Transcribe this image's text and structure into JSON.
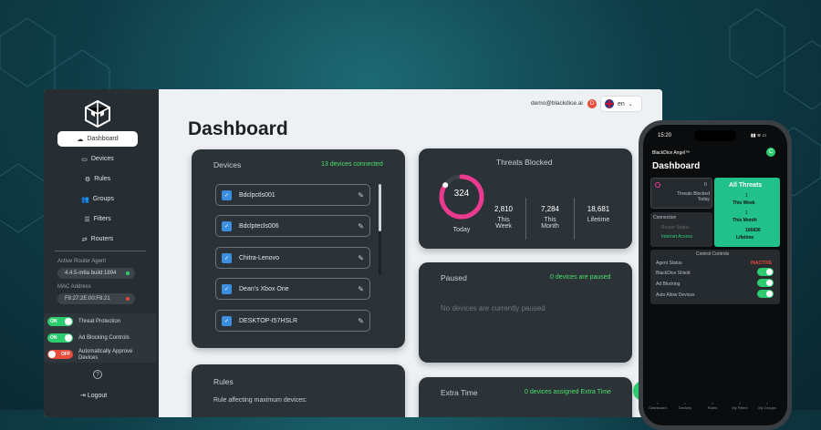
{
  "brand": {
    "colors": {
      "accent_green": "#4ee06a",
      "pink": "#ec3a8f",
      "card": "#2b3238"
    }
  },
  "sidebar": {
    "items": [
      {
        "label": "Dashboard",
        "icon": "cloud-icon",
        "active": true
      },
      {
        "label": "Devices",
        "icon": "monitor-icon"
      },
      {
        "label": "Rules",
        "icon": "gear-icon"
      },
      {
        "label": "Groups",
        "icon": "users-icon"
      },
      {
        "label": "Filters",
        "icon": "filter-icon"
      },
      {
        "label": "Routers",
        "icon": "router-icon"
      }
    ],
    "agent_label": "Active Router Agent",
    "agent_value": "4.4.5-m6a build:1894",
    "mac_label": "MAC Address",
    "mac_value": "F8:27:2E:00:F8:21",
    "toggles": [
      {
        "state": "ON",
        "label": "Threat Protection"
      },
      {
        "state": "ON",
        "label": "Ad Blocking Controls"
      },
      {
        "state": "OFF",
        "label": "Automatically Approve Devices"
      }
    ],
    "help": "?",
    "logout": "Logout"
  },
  "header": {
    "email": "demo@blackdice.ai",
    "badge": "D",
    "language": "en"
  },
  "main": {
    "title": "Dashboard",
    "devices": {
      "title": "Devices",
      "connected": "13 devices connected",
      "list": [
        "Bdclpctls001",
        "Bdclptecls006",
        "Chitra-Lenovo",
        "Dean's Xbox One",
        "DESKTOP-I57HSLR"
      ]
    },
    "threats": {
      "title": "Threats Blocked",
      "today_value": "324",
      "today_label": "Today",
      "today_fraction": 0.85,
      "stats": [
        {
          "value": "2,810",
          "label": "This Week"
        },
        {
          "value": "7,284",
          "label": "This Month"
        },
        {
          "value": "18,681",
          "label": "Lifetime"
        }
      ]
    },
    "paused": {
      "title": "Paused",
      "status": "0 devices are paused",
      "empty": "No devices are currently paused"
    },
    "rules": {
      "title": "Rules",
      "subtitle": "Rule affecting maximum devices:"
    },
    "extra_time": {
      "title": "Extra Time",
      "status": "0 devices assigned Extra Time"
    }
  },
  "phone": {
    "time": "15:20",
    "brand": "BlackDice Angel™",
    "avatar": "C",
    "title": "Dashboard",
    "threats_today_count": "0",
    "threats_today_label": "Threats Blocked Today",
    "all_threats": "All Threats",
    "week_count": "1",
    "week_label": "This Week",
    "month_count": "1",
    "month_label": "This Month",
    "lifetime_count": "106836",
    "lifetime_label": "Lifetime",
    "connection": "Connection",
    "router_status": "Router Status",
    "internet_access": "Internet Access",
    "controls_title": "Control Controls",
    "agent_status": "Agent Status",
    "agent_value": "INACTIVE",
    "rows": [
      "BlackDice Shield",
      "Ad Blocking",
      "Auto Allow Devices"
    ],
    "tabs": [
      "Dashboard",
      "Devices",
      "Rules",
      "My Filters",
      "My Groups"
    ]
  }
}
